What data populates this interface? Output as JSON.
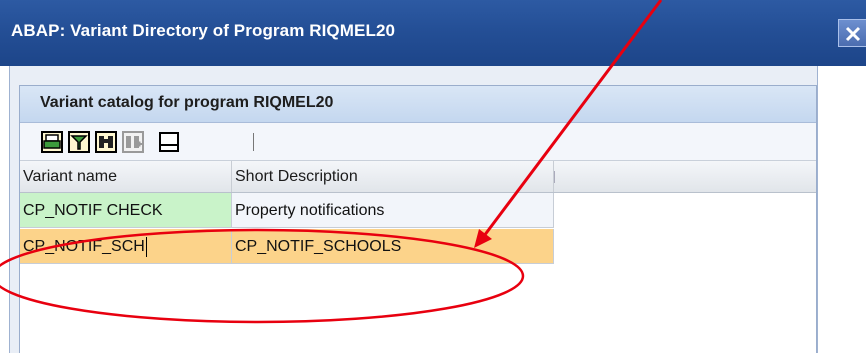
{
  "window": {
    "title": "ABAP: Variant Directory of Program RIQMEL20",
    "close_icon": "close-icon"
  },
  "panel": {
    "title": "Variant catalog for program RIQMEL20"
  },
  "toolbar": {
    "buttons": [
      "print-icon",
      "filter-icon",
      "find-icon",
      "find-next-icon",
      "local-file-icon"
    ]
  },
  "table": {
    "columns": [
      "Variant name",
      "Short Description"
    ],
    "rows": [
      {
        "variant": "CP_NOTIF CHECK",
        "description": "Property notifications"
      },
      {
        "variant": "CP_NOTIF_SCH",
        "description": "CP_NOTIF_SCHOOLS"
      }
    ]
  },
  "colors": {
    "title_bar": "#244f96",
    "row_green": "#c9f3c9",
    "row_selected": "#fcd38a",
    "annotation": "#e8000f"
  }
}
